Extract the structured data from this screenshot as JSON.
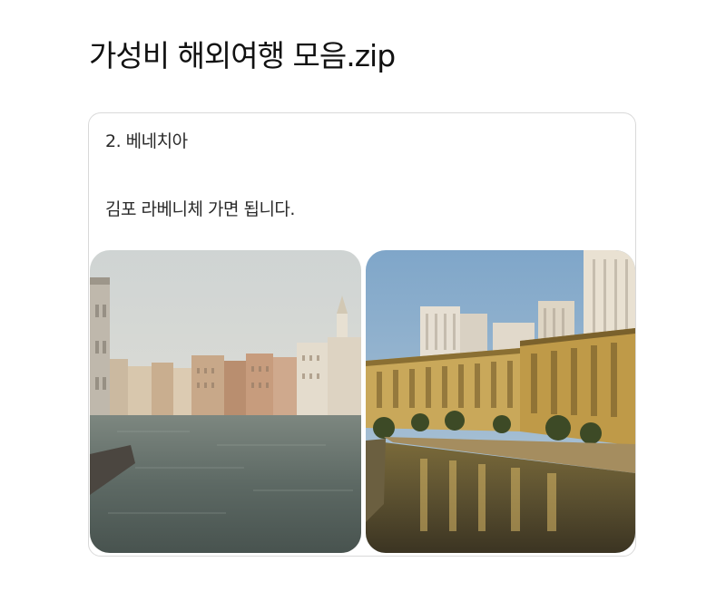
{
  "post": {
    "title": "가성비 해외여행 모음.zip"
  },
  "card": {
    "heading": "2. 베네치아",
    "body": "김포 라베니체 가면 됩니다."
  },
  "images": {
    "left": {
      "subject": "venice-grand-canal-photo"
    },
    "right": {
      "subject": "gimpo-la-venice-canal-photo"
    }
  },
  "colors": {
    "text": "#1a1a1a",
    "card_border": "#d9d9d9",
    "background": "#ffffff"
  }
}
